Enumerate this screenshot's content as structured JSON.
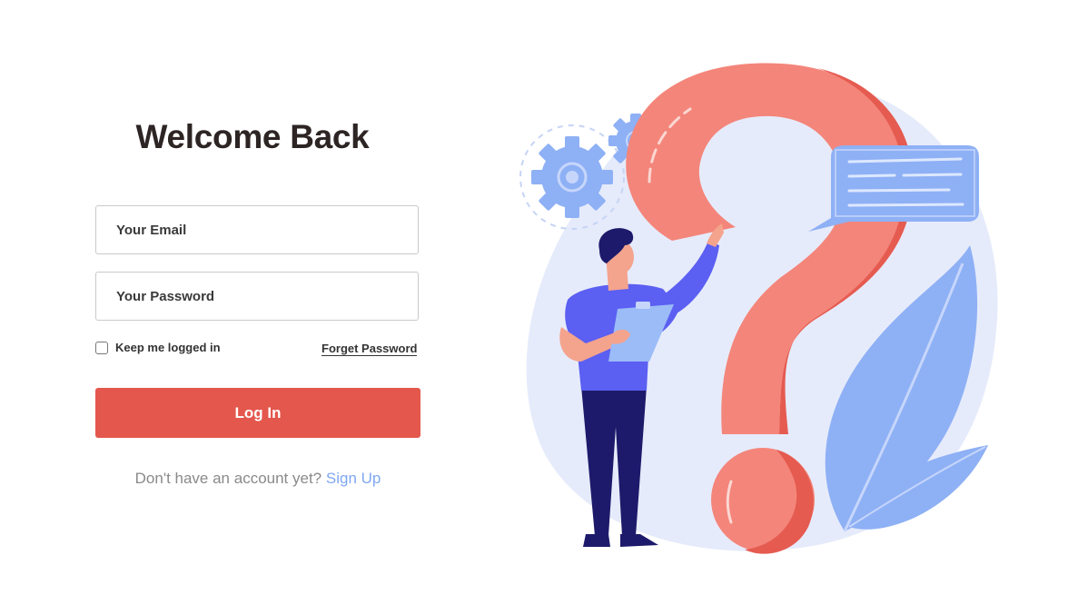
{
  "login": {
    "title": "Welcome Back",
    "email_placeholder": "Your Email",
    "password_placeholder": "Your Password",
    "remember_label": "Keep me logged in",
    "forget_label": "Forget Password",
    "login_button": "Log In",
    "signup_prompt": "Don't have an account yet?",
    "signup_link": "Sign Up"
  },
  "colors": {
    "accent": "#e4574c",
    "link": "#7fa7f1",
    "illustration_bg": "#e6ebfb",
    "question_mark": "#f4857a",
    "leaf": "#8eb0f5"
  }
}
